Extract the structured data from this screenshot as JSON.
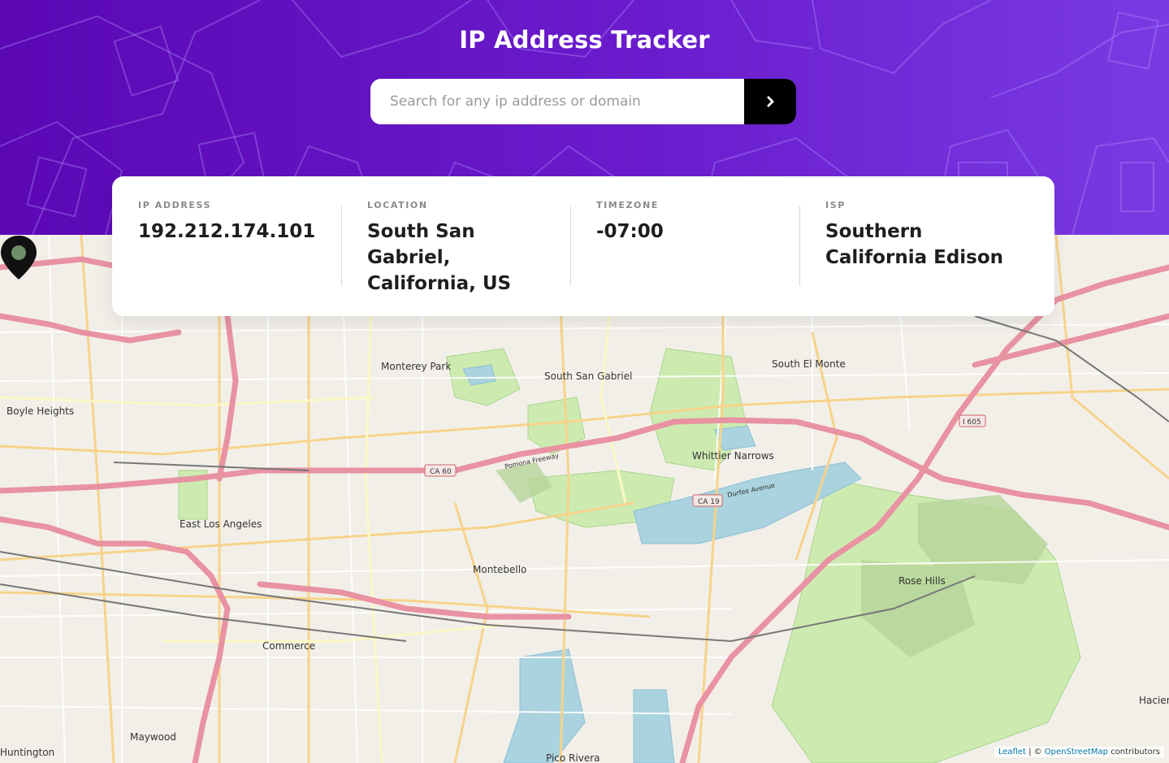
{
  "header": {
    "title": "IP Address Tracker",
    "search_placeholder": "Search for any ip address or domain",
    "search_value": ""
  },
  "info": {
    "ip": {
      "label": "IP ADDRESS",
      "value": "192.212.174.101"
    },
    "location": {
      "label": "LOCATION",
      "value": "South San Gabriel, California, US"
    },
    "timezone": {
      "label": "TIMEZONE",
      "value": "-07:00"
    },
    "isp": {
      "label": "ISP",
      "value": "Southern California Edison"
    }
  },
  "map": {
    "places": [
      "Monterey Park",
      "South San Gabriel",
      "South El Monte",
      "Boyle Heights",
      "Whittier Narrows",
      "East Los Angeles",
      "Montebello",
      "Commerce",
      "Rose Hills",
      "Maywood",
      "Huntington",
      "Pico Rivera",
      "Hacien"
    ],
    "roads": [
      "CA 60",
      "CA 19",
      "I 605",
      "Pomona Freeway",
      "Durfee Avenue"
    ],
    "attribution": {
      "leaflet": "Leaflet",
      "separator": " | © ",
      "osm": "OpenStreetMap",
      "suffix": " contributors"
    }
  },
  "colors": {
    "header_start": "#5b07b4",
    "header_end": "#7a3ae3",
    "button": "#000000",
    "motorway": "#e892a2",
    "park": "#cdebb0"
  },
  "icons": {
    "search_button": "chevron-right-icon",
    "marker": "location-pin-icon"
  }
}
